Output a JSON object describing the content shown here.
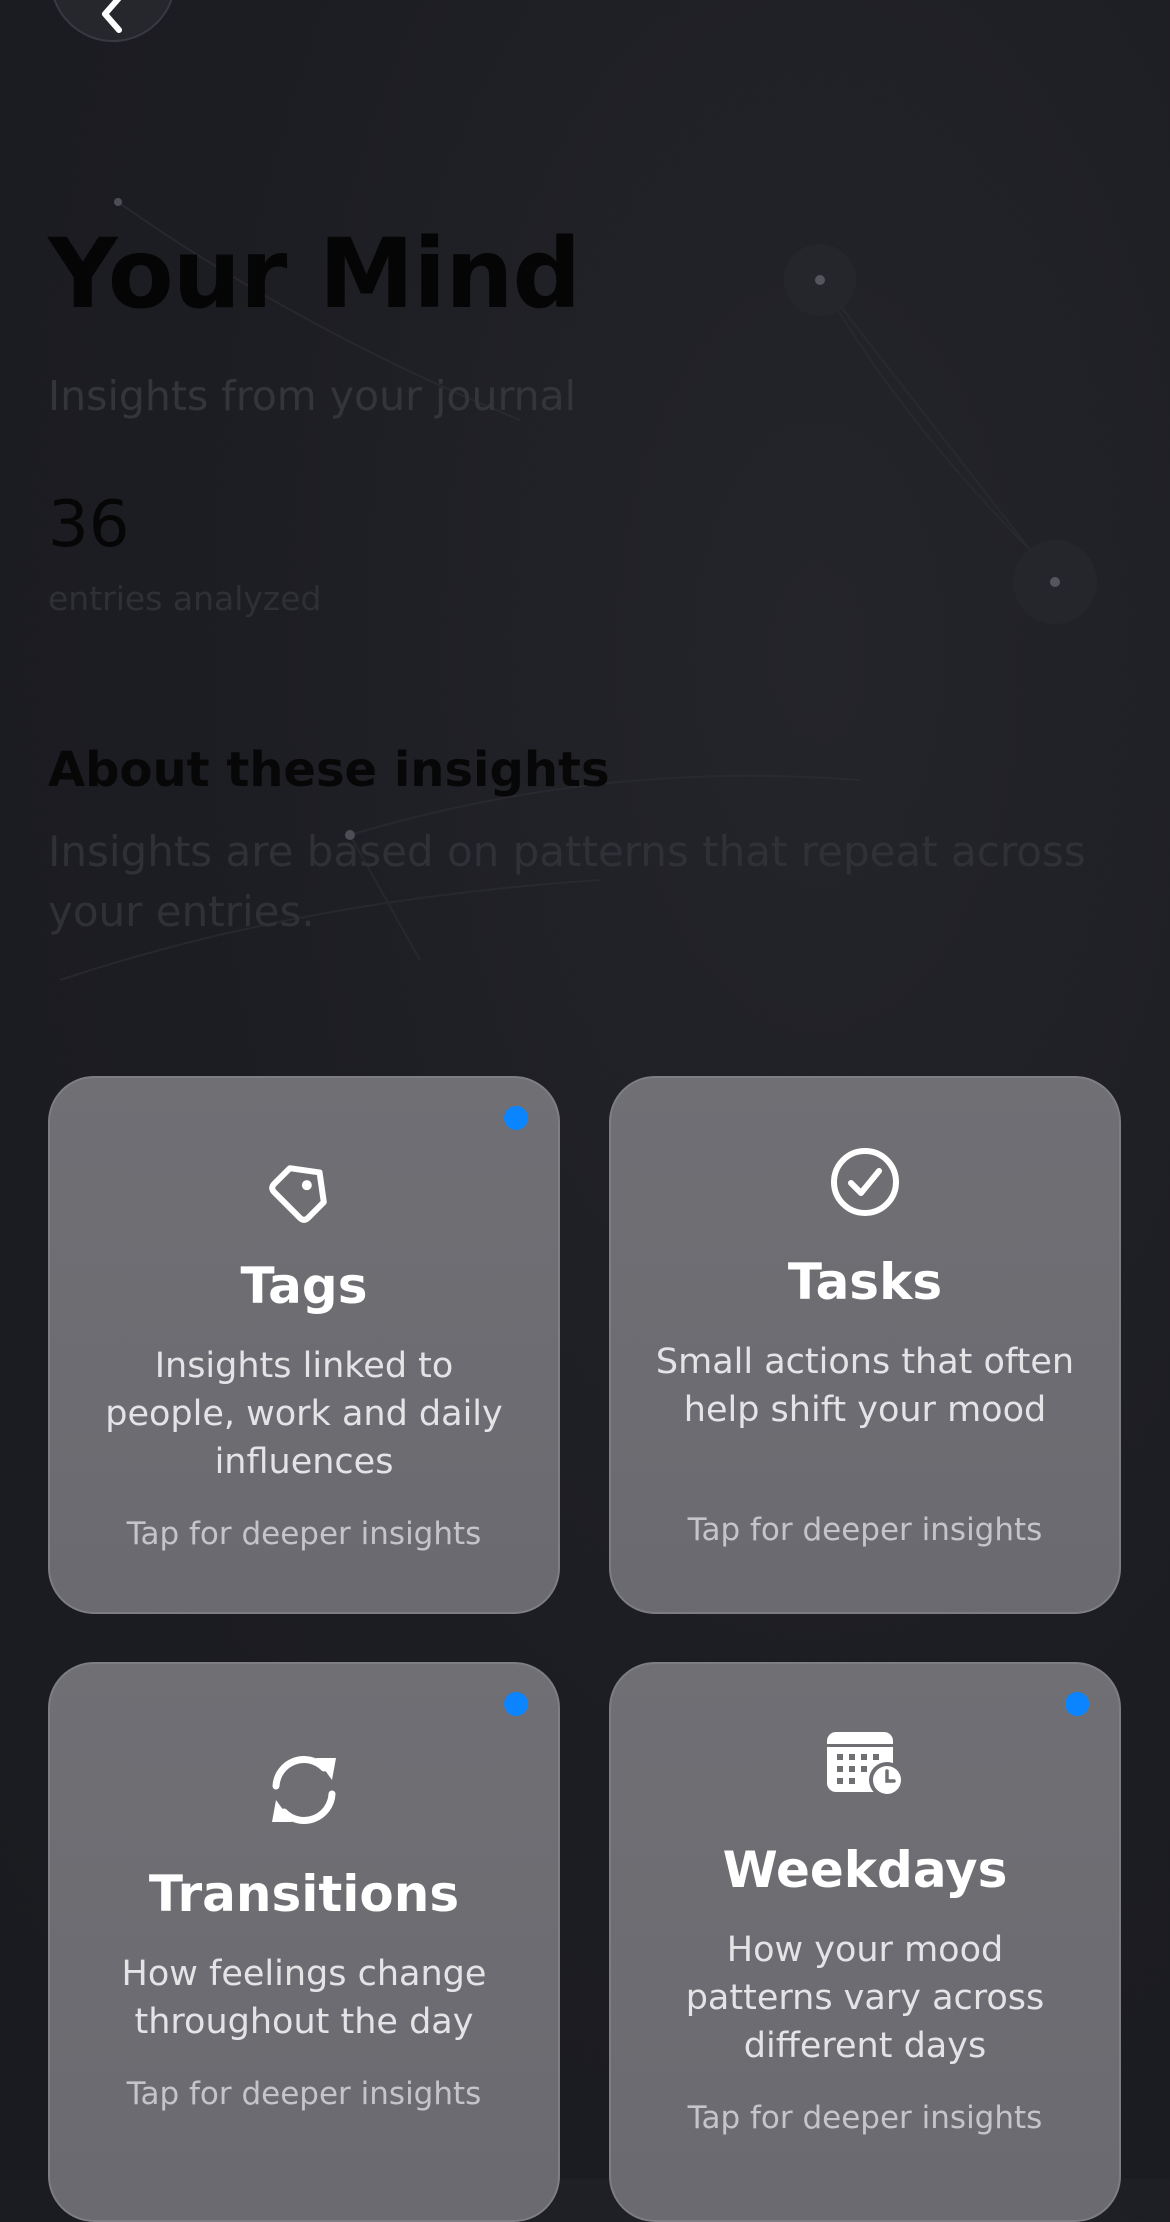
{
  "header": {
    "title": "Your Mind",
    "subtitle": "Insights from your journal",
    "back_icon": "chevron-left-icon"
  },
  "stats": {
    "count": "36",
    "count_label": "entries analyzed"
  },
  "about": {
    "heading": "About these insights",
    "body": "Insights are based on patterns that repeat across your entries."
  },
  "colors": {
    "background": "#1c1d22",
    "card": "#6e6e73",
    "new_indicator": "#0a84ff"
  },
  "cards": [
    {
      "title": "Tags",
      "description": "Insights linked to people, work and daily influences",
      "hint": "Tap for deeper insights",
      "icon": "tag-icon",
      "has_new": true
    },
    {
      "title": "Tasks",
      "description": "Small actions that often help shift your mood",
      "hint": "Tap for deeper insights",
      "icon": "checkmark-circle-icon",
      "has_new": false
    },
    {
      "title": "Transitions",
      "description": "How feelings change throughout the day",
      "hint": "Tap for deeper insights",
      "icon": "arrows-cycle-icon",
      "has_new": true
    },
    {
      "title": "Weekdays",
      "description": "How your mood patterns vary across different days",
      "hint": "Tap for deeper insights",
      "icon": "calendar-clock-icon",
      "has_new": true
    }
  ]
}
